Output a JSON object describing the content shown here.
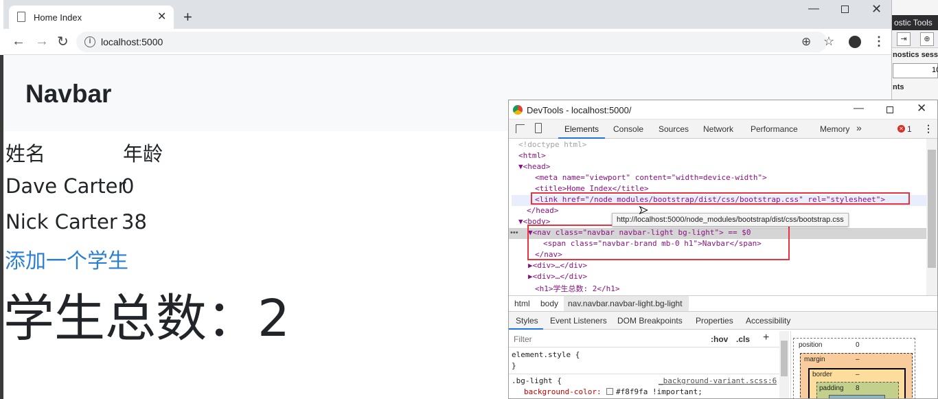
{
  "background_app": {
    "title_fragment": "ostic Tools",
    "label1": "nostics sessi",
    "grid_value": "10",
    "label2": "nts"
  },
  "browser": {
    "tab_title": "Home Index",
    "url": "localhost:5000"
  },
  "page": {
    "navbar_brand": "Navbar",
    "table": {
      "headers": [
        "姓名",
        "年龄"
      ],
      "rows": [
        {
          "name": "Dave Carter",
          "age": "0"
        },
        {
          "name": "Nick Carter",
          "age": "38"
        }
      ]
    },
    "add_link": "添加一个学生",
    "total": "学生总数：2"
  },
  "devtools": {
    "title": "DevTools - localhost:5000/",
    "tabs": [
      "Elements",
      "Console",
      "Sources",
      "Network",
      "Performance",
      "Memory"
    ],
    "more": "»",
    "error_count": "1",
    "tree": [
      "<!doctype html>",
      "<html>",
      "▼<head>",
      "<meta name=\"viewport\" content=\"width=device-width\">",
      "<title>Home Index</title>",
      "<link href=\"/node_modules/bootstrap/dist/css/bootstrap.css\" rel=\"stylesheet\">",
      "</head>",
      "▼<body>",
      "▼<nav class=\"navbar navbar-light bg-light\"> == $0",
      "<span class=\"navbar-brand mb-0 h1\">Navbar</span>",
      "</nav>",
      "▶<div>…</div>",
      "▶<div>…</div>",
      "<h1>学生总数: 2</h1>"
    ],
    "tooltip": "http://localhost:5000/node_modules/bootstrap/dist/css/bootstrap.css",
    "breadcrumbs": [
      "html",
      "body",
      "nav.navbar.navbar-light.bg-light"
    ],
    "subtabs": [
      "Styles",
      "Event Listeners",
      "DOM Breakpoints",
      "Properties",
      "Accessibility"
    ],
    "filter_placeholder": "Filter",
    "hov": ":hov",
    "cls": ".cls",
    "plus": "+",
    "styles": {
      "element_style": "element.style {",
      "close1": "}",
      "selector": ".bg-light {",
      "source": "_background-variant.scss:6",
      "declaration_prop": "background-color:",
      "declaration_val": "#f8f9fa !important;"
    },
    "boxmodel": {
      "position_label": "position",
      "position_val": "0",
      "margin_label": "margin",
      "margin_val": "–",
      "border_label": "border",
      "border_val": "–",
      "padding_label": "padding",
      "padding_val": "8"
    }
  }
}
